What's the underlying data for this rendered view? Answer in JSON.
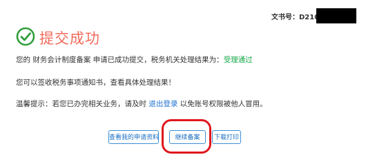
{
  "header": {
    "doc_no_label": "文书号：",
    "doc_no_value": "D210125"
  },
  "status": {
    "title": "提交成功",
    "icon": "check-circle-icon",
    "color": "#f26b5b",
    "icon_color": "#2e9e3b"
  },
  "message": {
    "prefix": "您的 财务会计制度备案 申请已成功提交，税务机关处理结果为：",
    "result": "受理通过",
    "notice": "您可以签收税务事项通知书，查看具体处理结果！",
    "tip_prefix": "温馨提示：若您已办完相关业务，请及时 ",
    "logout_link": "退出登录",
    "tip_suffix": " 以免账号权限被他人冒用。"
  },
  "actions": {
    "view_records": "查看我的申请资料",
    "continue_filing": "继续备案",
    "download_print": "下载打印"
  },
  "colors": {
    "accent_blue": "#1a6fc4",
    "success_green": "#17a84a",
    "annotation_red": "#e0161c"
  }
}
